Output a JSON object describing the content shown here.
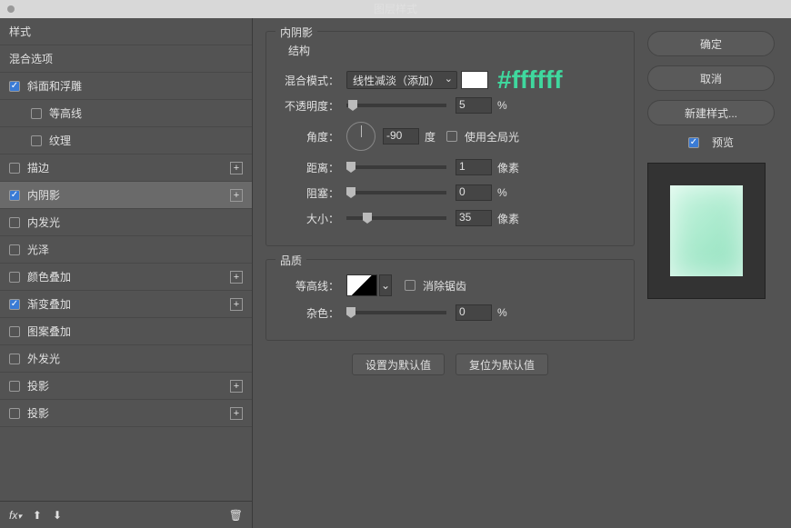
{
  "window": {
    "title": "图层样式"
  },
  "sidebar": {
    "header1": "样式",
    "header2": "混合选项",
    "items": [
      {
        "label": "斜面和浮雕",
        "checked": true,
        "indent": false,
        "plus": false,
        "selected": false
      },
      {
        "label": "等高线",
        "checked": false,
        "indent": true,
        "plus": false,
        "selected": false
      },
      {
        "label": "纹理",
        "checked": false,
        "indent": true,
        "plus": false,
        "selected": false
      },
      {
        "label": "描边",
        "checked": false,
        "indent": false,
        "plus": true,
        "selected": false
      },
      {
        "label": "内阴影",
        "checked": true,
        "indent": false,
        "plus": true,
        "selected": true
      },
      {
        "label": "内发光",
        "checked": false,
        "indent": false,
        "plus": false,
        "selected": false
      },
      {
        "label": "光泽",
        "checked": false,
        "indent": false,
        "plus": false,
        "selected": false
      },
      {
        "label": "颜色叠加",
        "checked": false,
        "indent": false,
        "plus": true,
        "selected": false
      },
      {
        "label": "渐变叠加",
        "checked": true,
        "indent": false,
        "plus": true,
        "selected": false
      },
      {
        "label": "图案叠加",
        "checked": false,
        "indent": false,
        "plus": false,
        "selected": false
      },
      {
        "label": "外发光",
        "checked": false,
        "indent": false,
        "plus": false,
        "selected": false
      },
      {
        "label": "投影",
        "checked": false,
        "indent": false,
        "plus": true,
        "selected": false
      },
      {
        "label": "投影",
        "checked": false,
        "indent": false,
        "plus": true,
        "selected": false
      }
    ],
    "fx_label": "fx"
  },
  "panel": {
    "title": "内阴影",
    "structure": "结构",
    "blend_mode_label": "混合模式：",
    "blend_mode_value": "线性减淡（添加）",
    "color_hex": "#ffffff",
    "opacity_label": "不透明度：",
    "opacity_value": "5",
    "opacity_unit": "%",
    "angle_label": "角度：",
    "angle_value": "-90",
    "angle_unit": "度",
    "global_light": "使用全局光",
    "distance_label": "距离：",
    "distance_value": "1",
    "distance_unit": "像素",
    "choke_label": "阻塞：",
    "choke_value": "0",
    "choke_unit": "%",
    "size_label": "大小：",
    "size_value": "35",
    "size_unit": "像素",
    "quality": "品质",
    "contour_label": "等高线：",
    "antialias": "消除锯齿",
    "noise_label": "杂色：",
    "noise_value": "0",
    "noise_unit": "%",
    "default_btn": "设置为默认值",
    "reset_btn": "复位为默认值"
  },
  "right": {
    "ok": "确定",
    "cancel": "取消",
    "new_style": "新建样式...",
    "preview": "预览"
  }
}
